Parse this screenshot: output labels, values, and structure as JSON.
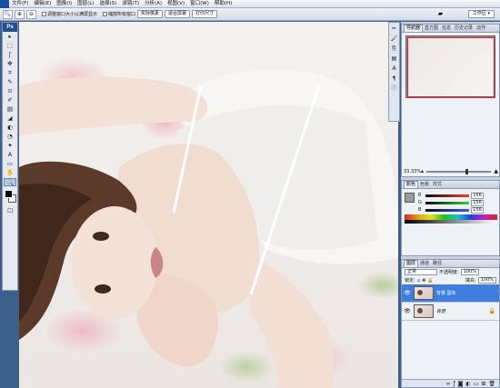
{
  "menubar": {
    "items": [
      "文件(F)",
      "编辑(E)",
      "图像(I)",
      "图层(L)",
      "选择(S)",
      "滤镜(T)",
      "分析(A)",
      "视图(V)",
      "窗口(W)",
      "帮助(H)"
    ]
  },
  "options": {
    "check1": "调整窗口大小以满屏显示",
    "check2": "缩放所有窗口",
    "btn_actual": "实际像素",
    "btn_fit": "适合屏幕",
    "btn_print": "打印尺寸",
    "workspace": "工作区 ▾"
  },
  "toolbox": {
    "logo": "Ps",
    "tools": [
      "▸",
      "⬚",
      "ʃ",
      "✥",
      "⌗",
      "✎",
      "⊙",
      "✐",
      "▤",
      "◢",
      "◐",
      "◔",
      "✦",
      "A",
      "▭",
      "✋",
      "🔍",
      "☐"
    ]
  },
  "navigator": {
    "tabs": [
      "导航器",
      "直方图",
      "信息",
      "历史记录",
      "动作"
    ],
    "zoom": "33.33%"
  },
  "color_panel": {
    "tabs": [
      "颜色",
      "色板",
      "样式"
    ],
    "channels": [
      {
        "label": "R",
        "value": "156"
      },
      {
        "label": "G",
        "value": "156"
      },
      {
        "label": "B",
        "value": "156"
      }
    ],
    "swatch_color": "#9b9b9b"
  },
  "layers_panel": {
    "tabs": [
      "图层",
      "通道",
      "路径"
    ],
    "blend_mode": "正常",
    "opacity_label": "不透明度:",
    "opacity_value": "100%",
    "lock_label": "锁定:",
    "fill_label": "填充:",
    "fill_value": "100%",
    "layers": [
      {
        "name": "背景 副本",
        "active": true
      },
      {
        "name": "背景",
        "active": false
      }
    ]
  },
  "colors": {
    "accent": "#3d7ede",
    "desktop": "#3d5f8c"
  }
}
